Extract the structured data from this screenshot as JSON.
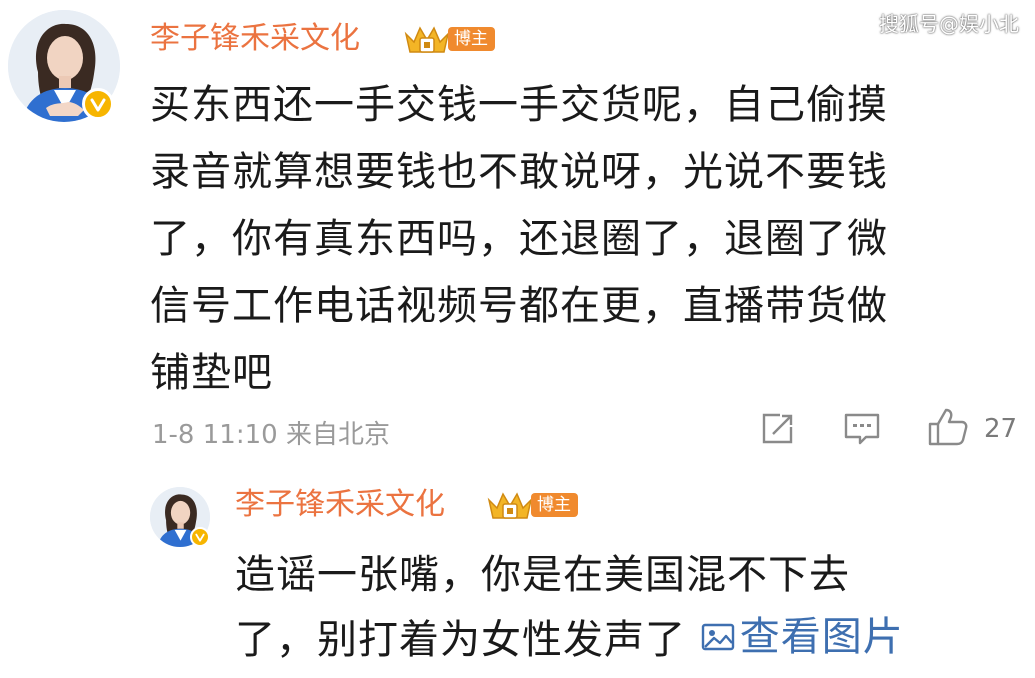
{
  "watermark": "搜狐号@娱小北",
  "comment": {
    "author": "李子锋禾采文化",
    "badge_label": "博主",
    "content_lines": [
      "买东西还一手交钱一手交货呢，自己偷摸",
      "录音就算想要钱也不敢说呀，光说不要钱",
      "了，你有真东西吗，还退圈了，退圈了微",
      "信号工作电话视频号都在更，直播带货做",
      "铺垫吧"
    ],
    "timestamp": "1-8 11:10",
    "location": "来自北京",
    "like_count": "27",
    "icons": [
      "share-icon",
      "comment-icon",
      "like-icon"
    ]
  },
  "reply": {
    "author": "李子锋禾采文化",
    "badge_label": "博主",
    "content_lines": [
      "造谣一张嘴，你是在美国混不下去",
      "了，别打着为女性发声了"
    ],
    "view_image_label": "查看图片"
  },
  "colors": {
    "author": "#eb7340",
    "badge": "#f08a2e",
    "verified": "#f7b500",
    "link": "#3e6fb0",
    "meta": "#9a9a9a"
  }
}
